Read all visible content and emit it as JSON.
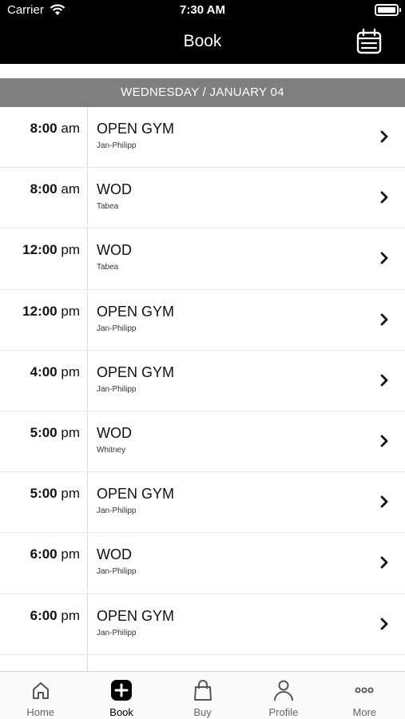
{
  "status_bar": {
    "carrier": "Carrier",
    "time": "7:30 AM"
  },
  "nav": {
    "title": "Book",
    "action_icon": "calendar-icon"
  },
  "date_header": "WEDNESDAY / JANUARY 04",
  "classes": [
    {
      "time": "8:00",
      "ampm": "am",
      "name": "OPEN GYM",
      "coach": "Jan-Philipp"
    },
    {
      "time": "8:00",
      "ampm": "am",
      "name": "WOD",
      "coach": "Tabea"
    },
    {
      "time": "12:00",
      "ampm": "pm",
      "name": "WOD",
      "coach": "Tabea"
    },
    {
      "time": "12:00",
      "ampm": "pm",
      "name": "OPEN GYM",
      "coach": "Jan-Philipp"
    },
    {
      "time": "4:00",
      "ampm": "pm",
      "name": "OPEN GYM",
      "coach": "Jan-Philipp"
    },
    {
      "time": "5:00",
      "ampm": "pm",
      "name": "WOD",
      "coach": "Whitney"
    },
    {
      "time": "5:00",
      "ampm": "pm",
      "name": "OPEN GYM",
      "coach": "Jan-Philipp"
    },
    {
      "time": "6:00",
      "ampm": "pm",
      "name": "WOD",
      "coach": "Jan-Philipp"
    },
    {
      "time": "6:00",
      "ampm": "pm",
      "name": "OPEN GYM",
      "coach": "Jan-Philipp"
    }
  ],
  "tabs": [
    {
      "label": "Home",
      "icon": "home-icon"
    },
    {
      "label": "Book",
      "icon": "plus-square-icon",
      "active": true
    },
    {
      "label": "Buy",
      "icon": "shopping-bag-icon"
    },
    {
      "label": "Profile",
      "icon": "person-icon"
    },
    {
      "label": "More",
      "icon": "ellipsis-icon"
    }
  ],
  "colors": {
    "bar": "#000000",
    "date_header": "#7f7f7f",
    "inactive_tab": "#666666"
  }
}
